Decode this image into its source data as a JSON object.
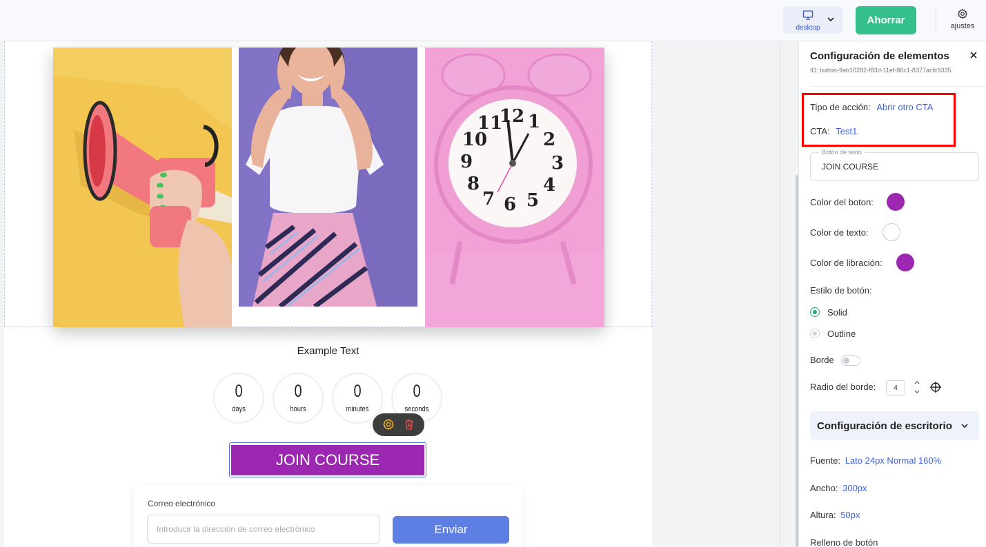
{
  "topbar": {
    "device_label": "desktop",
    "save_label": "Ahorrar",
    "settings_label": "ajustes"
  },
  "canvas": {
    "hero": {
      "panels": [
        "megaphone-photo",
        "woman-photo",
        "alarm-clock-photo"
      ],
      "clock_numbers": [
        "12",
        "1",
        "2",
        "3",
        "4",
        "5",
        "6",
        "7",
        "8",
        "9",
        "10",
        "11"
      ]
    },
    "example_text": "Example Text",
    "countdown": [
      {
        "value": "0",
        "label": "days"
      },
      {
        "value": "0",
        "label": "hours"
      },
      {
        "value": "0",
        "label": "minutes"
      },
      {
        "value": "0",
        "label": "seconds"
      }
    ],
    "cta_button_label": "JOIN COURSE",
    "form": {
      "email_label": "Correo electrónico",
      "email_placeholder": "Introducir la dirección de correo electrónico",
      "submit_label": "Enviar"
    }
  },
  "panel": {
    "title": "Configuración de elementos",
    "element_id": "ID: button-9ab10282-f83d-11ef-86c1-8377acfc9335",
    "action_type_label": "Tipo de acción:",
    "action_type_value": "Abrir otro CTA",
    "cta_label": "CTA:",
    "cta_value": "Test1",
    "text_button_legend": "Botón de texto",
    "text_button_value": "JOIN COURSE",
    "button_color_label": "Color del boton:",
    "button_color": "#9c27b0",
    "text_color_label": "Color de texto:",
    "text_color": "#ffffff",
    "vibration_color_label": "Color de libración:",
    "vibration_color": "#9c27b0",
    "button_style_label": "Estilo de botón:",
    "style_options": [
      "Solid",
      "Outline"
    ],
    "style_selected": "Solid",
    "border_label": "Borde",
    "border_on": false,
    "radius_label": "Radio del borde:",
    "radius_value": "4",
    "desktop_config_label": "Configuración de escritorio",
    "font_label": "Fuente:",
    "font_value": "Lato 24px Normal 160%",
    "width_label": "Ancho:",
    "width_value": "300px",
    "height_label": "Altura:",
    "height_value": "50px",
    "padding_label": "Relleno de botón"
  },
  "colors": {
    "accent_green": "#33c08b",
    "link_blue": "#3d63dd",
    "cta_purple": "#9c27b0",
    "submit_blue": "#5d7fe3",
    "highlight_red": "#ff0000"
  }
}
